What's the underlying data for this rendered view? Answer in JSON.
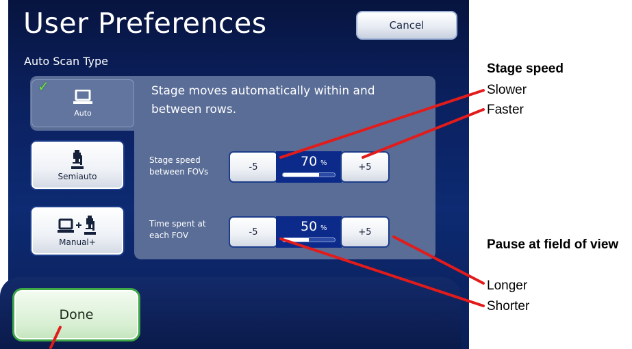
{
  "header": {
    "title": "User Preferences",
    "cancel_label": "Cancel"
  },
  "section": {
    "label": "Auto Scan Type"
  },
  "modes": [
    {
      "label": "Auto",
      "icon": "laptop-icon",
      "selected": true
    },
    {
      "label": "Semiauto",
      "icon": "microscope-icon"
    },
    {
      "label": "Manual+",
      "icon": "laptop-plus-microscope-icon"
    }
  ],
  "panel": {
    "description": "Stage moves automatically within and between rows.",
    "speed": {
      "label_line1": "Stage speed",
      "label_line2": "between FOVs",
      "minus": "-5",
      "plus": "+5",
      "value": "70",
      "unit": "%",
      "level": 0.7
    },
    "pause": {
      "label_line1": "Time spent at",
      "label_line2": "each FOV",
      "minus": "-5",
      "plus": "+5",
      "value": "50",
      "unit": "%",
      "level": 0.5
    }
  },
  "footer": {
    "done_label": "Done"
  },
  "callouts": {
    "stage_speed": "Stage speed",
    "slower": "Slower",
    "faster": "Faster",
    "pause": "Pause at field of view",
    "longer": "Longer",
    "shorter": "Shorter"
  },
  "colors": {
    "accent_line": "#e21b1b",
    "selected_check": "#6fe34d",
    "done_border": "#3ea846"
  }
}
